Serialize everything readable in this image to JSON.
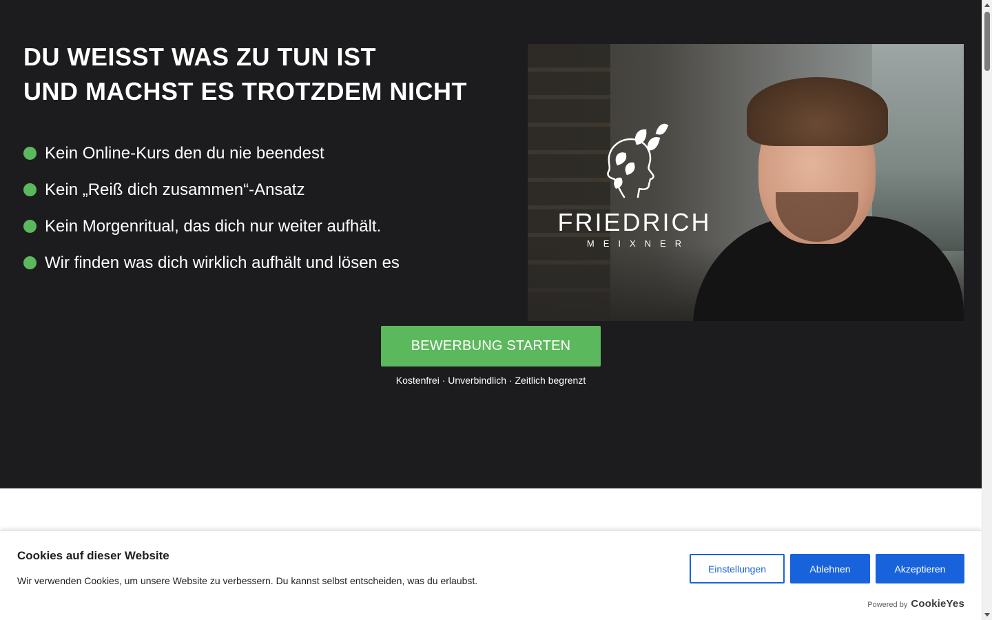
{
  "hero": {
    "headline_line1": "DU WEISST WAS ZU TUN IST",
    "headline_line2": "UND MACHST ES TROTZDEM NICHT",
    "bullets": [
      {
        "text": "Kein Online-Kurs den du nie beendest"
      },
      {
        "text": "Kein „Reiß dich zusammen“-Ansatz"
      },
      {
        "text": "Kein Morgenritual, das dich nur weiter aufhält."
      },
      {
        "text": "Wir finden was dich wirklich aufhält und lösen es"
      }
    ],
    "bullet_icon": "green-dot-icon",
    "bullet_color": "#5cb85c",
    "background_color": "#1c1c1e"
  },
  "brand": {
    "name": "FRIEDRICH",
    "sub": "MEIXNER",
    "logo_icon": "head-with-leaves-icon"
  },
  "cta": {
    "label": "BEWERBUNG STARTEN",
    "note": "Kostenfrei · Unverbindlich · Zeitlich begrenzt",
    "color": "#5cb85c"
  },
  "cookie": {
    "title": "Cookies auf dieser Website",
    "text": "Wir verwenden Cookies, um unsere Website zu verbessern. Du kannst selbst entscheiden, was du erlaubst.",
    "settings_label": "Einstellungen",
    "reject_label": "Ablehnen",
    "accept_label": "Akzeptieren",
    "powered_label": "Powered by",
    "powered_brand": "CookieYes",
    "accent_color": "#1863dc"
  }
}
